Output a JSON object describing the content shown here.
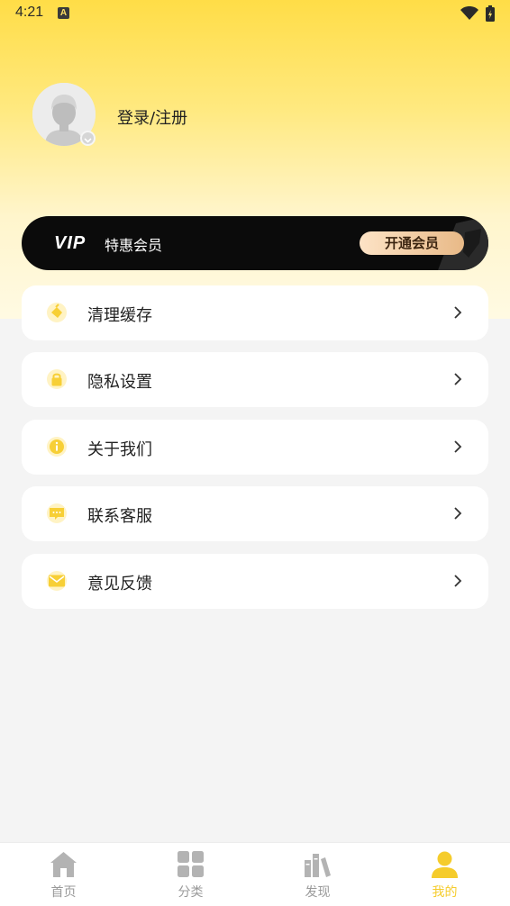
{
  "status_bar": {
    "time": "4:21",
    "notification_letter": "A"
  },
  "profile": {
    "login_text": "登录/注册"
  },
  "vip": {
    "logo": "VIP",
    "label": "特惠会员",
    "open_button": "开通会员"
  },
  "menu": [
    {
      "label": "清理缓存",
      "icon": "broom-icon"
    },
    {
      "label": "隐私设置",
      "icon": "lock-icon"
    },
    {
      "label": "关于我们",
      "icon": "info-icon"
    },
    {
      "label": "联系客服",
      "icon": "message-icon"
    },
    {
      "label": "意见反馈",
      "icon": "mail-icon"
    }
  ],
  "tabs": [
    {
      "label": "首页",
      "icon": "home-icon",
      "active": false
    },
    {
      "label": "分类",
      "icon": "grid-icon",
      "active": false
    },
    {
      "label": "发现",
      "icon": "books-icon",
      "active": false
    },
    {
      "label": "我的",
      "icon": "user-icon",
      "active": true
    }
  ],
  "colors": {
    "accent": "#f5cc2c",
    "header_gradient_top": "#ffdd47",
    "vip_bar": "#0b0b0b",
    "background": "#f4f4f4"
  }
}
